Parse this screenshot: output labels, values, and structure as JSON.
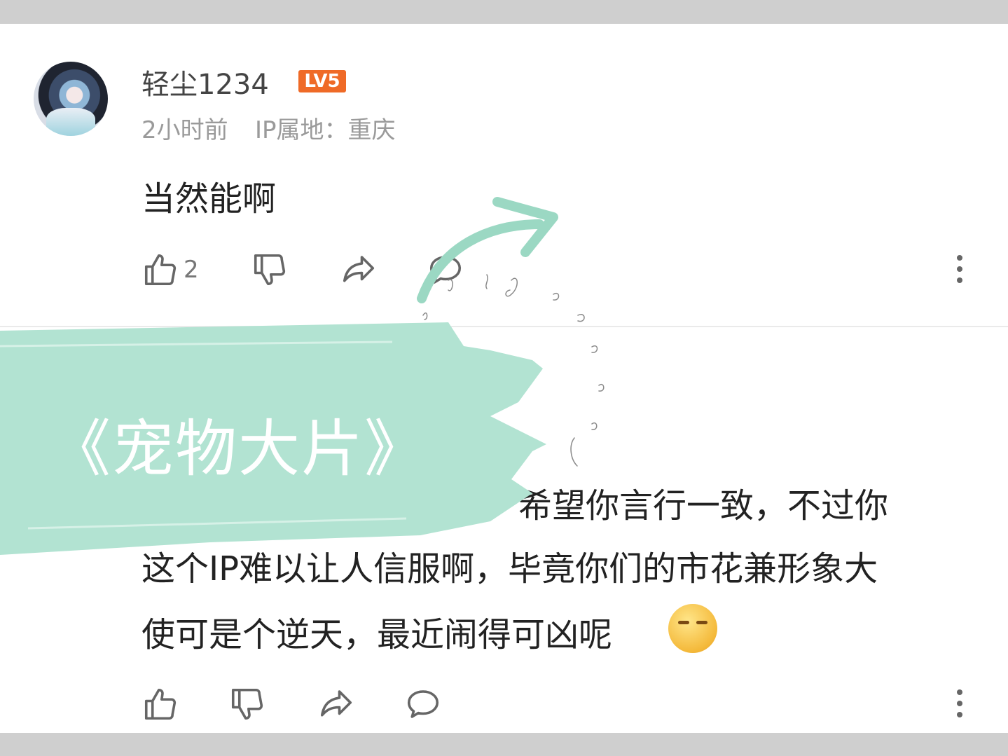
{
  "comment1": {
    "username": "轻尘1234",
    "level": "LV5",
    "time": "2小时前",
    "ip": "IP属地：重庆",
    "text": "当然能啊",
    "likes": "2"
  },
  "comment2": {
    "text_line1": "希望你言行一致，不过你",
    "text_line2": "这个IP难以让人信服啊，毕竟你们的市花兼形象大",
    "text_line3": "使可是个逆天，最近闹得可凶呢"
  },
  "overlay": {
    "title": "《宠物大片》"
  },
  "colors": {
    "level_badge": "#ef6a27",
    "banner": "#b2e3d2",
    "arrow": "#9bd8c3"
  },
  "icons": [
    "thumb-up-icon",
    "thumb-down-icon",
    "share-icon",
    "comment-icon",
    "more-icon",
    "emoji-icon"
  ]
}
